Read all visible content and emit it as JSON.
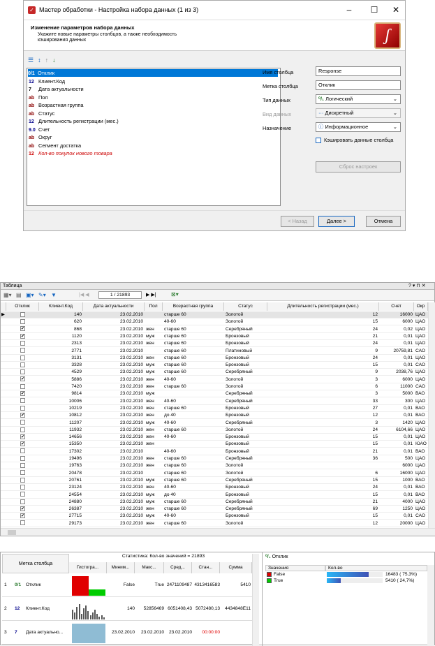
{
  "wizard": {
    "title": "Мастер обработки - Настройка набора данных (1 из 3)",
    "header_title": "Изменение параметров набора данных",
    "header_desc1": "Укажите новые параметры столбцов, а также необходимость",
    "header_desc2": "кэширования данных",
    "fields": [
      {
        "type": "0/1",
        "name": "Отклик",
        "color": "#006400",
        "selected": true
      },
      {
        "type": "12",
        "name": "Клиент.Код",
        "color": "#00008b"
      },
      {
        "type": "7",
        "name": "Дата актуальности",
        "color": "#000"
      },
      {
        "type": "ab",
        "name": "Пол",
        "color": "#8b0000"
      },
      {
        "type": "ab",
        "name": "Возрастная группа",
        "color": "#8b0000"
      },
      {
        "type": "ab",
        "name": "Статус",
        "color": "#8b0000"
      },
      {
        "type": "12",
        "name": "Длительность регистрации (мес.)",
        "color": "#00008b"
      },
      {
        "type": "9.0",
        "name": "Счет",
        "color": "#00008b"
      },
      {
        "type": "ab",
        "name": "Округ",
        "color": "#8b0000"
      },
      {
        "type": "ab",
        "name": "Сегмент достатка",
        "color": "#8b0000"
      },
      {
        "type": "12",
        "name": "Кол-во покупок нового товара",
        "color": "#cc0000",
        "italic": true
      }
    ],
    "labels": {
      "col_name": "Имя столбца",
      "col_label": "Метка столбца",
      "data_type": "Тип данных",
      "data_kind": "Вид данных",
      "purpose": "Назначение"
    },
    "values": {
      "col_name": "Response",
      "col_label": "Отклик",
      "data_type": "Логический",
      "data_kind": "Дискретный",
      "purpose": "Информационное"
    },
    "cache_label": "Кэшировать данные столбца",
    "reset_label": "Сброс настроек",
    "back_label": "< Назад",
    "next_label": "Далее >",
    "cancel_label": "Отмена"
  },
  "table": {
    "title": "Таблица",
    "nav": "1 / 21893",
    "columns": [
      "Отклик",
      "Клиент.Код",
      "Дата актуальности",
      "Пол",
      "Возрастная группа",
      "Статус",
      "Длительность регистрации (мес.)",
      "Счет",
      "Окр"
    ],
    "rows": [
      [
        false,
        "140",
        "23.02.2010",
        "",
        "старше 60",
        "Золотой",
        "12",
        "16000",
        "ЦАО"
      ],
      [
        false,
        "620",
        "23.02.2010",
        "",
        "40-60",
        "Золотой",
        "15",
        "6000",
        "ЦАО"
      ],
      [
        true,
        "868",
        "23.02.2010",
        "жен",
        "старше 60",
        "Серебряный",
        "24",
        "0,02",
        "ЦАО"
      ],
      [
        true,
        "1120",
        "23.02.2010",
        "муж",
        "старше 60",
        "Бронзовый",
        "21",
        "0,01",
        "ЦАО"
      ],
      [
        false,
        "2313",
        "23.02.2010",
        "жен",
        "старше 60",
        "Бронзовый",
        "24",
        "0,01",
        "ЦАО"
      ],
      [
        false,
        "2771",
        "23.02.2010",
        "",
        "старше 60",
        "Платиновый",
        "9",
        "20759,81",
        "САО"
      ],
      [
        false,
        "3131",
        "23.02.2010",
        "жен",
        "старше 60",
        "Бронзовый",
        "24",
        "0,01",
        "ЦАО"
      ],
      [
        false,
        "3328",
        "23.02.2010",
        "муж",
        "старше 60",
        "Бронзовый",
        "15",
        "0,01",
        "САО"
      ],
      [
        false,
        "4529",
        "23.02.2010",
        "муж",
        "старше 60",
        "Серебряный",
        "9",
        "2038,76",
        "ЦАО"
      ],
      [
        true,
        "5886",
        "23.02.2010",
        "жен",
        "40-60",
        "Золотой",
        "3",
        "6000",
        "ЦАО"
      ],
      [
        false,
        "7420",
        "23.02.2010",
        "жен",
        "старше 60",
        "Золотой",
        "6",
        "11000",
        "САО"
      ],
      [
        true,
        "9814",
        "23.02.2010",
        "муж",
        "",
        "Серебряный",
        "3",
        "5000",
        "ВАО"
      ],
      [
        false,
        "10006",
        "23.02.2010",
        "жен",
        "40-60",
        "Серебряный",
        "33",
        "300",
        "ЦАО"
      ],
      [
        false,
        "10219",
        "23.02.2010",
        "жен",
        "старше 60",
        "Бронзовый",
        "27",
        "0,01",
        "ВАО"
      ],
      [
        true,
        "10812",
        "23.02.2010",
        "жен",
        "до 40",
        "Бронзовый",
        "12",
        "0,01",
        "ВАО"
      ],
      [
        false,
        "11207",
        "23.02.2010",
        "муж",
        "40-60",
        "Серебряный",
        "3",
        "1420",
        "ЦАО"
      ],
      [
        false,
        "11932",
        "23.02.2010",
        "жен",
        "старше 60",
        "Золотой",
        "24",
        "6104,66",
        "ЦАО"
      ],
      [
        true,
        "14656",
        "23.02.2010",
        "жен",
        "40-60",
        "Бронзовый",
        "15",
        "0,01",
        "ЦАО"
      ],
      [
        true,
        "15350",
        "23.02.2010",
        "жен",
        "",
        "Бронзовый",
        "15",
        "0,01",
        "ЮАО"
      ],
      [
        false,
        "17302",
        "23.02.2010",
        "",
        "40-60",
        "Бронзовый",
        "21",
        "0,01",
        "ВАО"
      ],
      [
        false,
        "19496",
        "23.02.2010",
        "жен",
        "старше 60",
        "Серебряный",
        "36",
        "500",
        "ЦАО"
      ],
      [
        false,
        "19763",
        "23.02.2010",
        "жен",
        "старше 60",
        "Золотой",
        "",
        "6000",
        "ЦАО"
      ],
      [
        false,
        "20478",
        "23.02.2010",
        "",
        "старше 60",
        "Золотой",
        "6",
        "16000",
        "ЦАО"
      ],
      [
        false,
        "20761",
        "23.02.2010",
        "муж",
        "старше 60",
        "Серебряный",
        "15",
        "1000",
        "ВАО"
      ],
      [
        false,
        "23124",
        "23.02.2010",
        "жен",
        "40-60",
        "Бронзовый",
        "24",
        "0,01",
        "ВАО"
      ],
      [
        false,
        "24554",
        "23.02.2010",
        "муж",
        "до 40",
        "Бронзовый",
        "15",
        "0,01",
        "ВАО"
      ],
      [
        false,
        "24880",
        "23.02.2010",
        "муж",
        "старше 60",
        "Серебряный",
        "21",
        "4000",
        "ЦАО"
      ],
      [
        true,
        "26387",
        "23.02.2010",
        "жен",
        "старше 60",
        "Серебряный",
        "69",
        "1250",
        "ЦАО"
      ],
      [
        true,
        "27715",
        "23.02.2010",
        "муж",
        "40-60",
        "Бронзовый",
        "15",
        "0,01",
        "САО"
      ],
      [
        false,
        "29173",
        "23.02.2010",
        "жен",
        "старше 60",
        "Золотой",
        "12",
        "20000",
        "ЦАО"
      ]
    ]
  },
  "stats": {
    "header": "Статистика: Кол-во значений = 21893",
    "col_label": "Метка столбца",
    "col_headers": [
      "Гистогра...",
      "Миним...",
      "Макс...",
      "Сред...",
      "Стан...",
      "Сумма"
    ],
    "rows": [
      {
        "n": "1",
        "name": "Отклик",
        "type": "0/1",
        "min": "False",
        "max": "True",
        "avg": "2471109487",
        "std": "4313416583",
        "sum": "5410"
      },
      {
        "n": "2",
        "name": "Клиент.Код",
        "type": "12",
        "min": "140",
        "max": "52856469",
        "avg": "6051408,43",
        "std": "5072480,13",
        "sum": "4434848E11"
      },
      {
        "n": "3",
        "name": "Дата актуально...",
        "type": "7",
        "min": "23.02.2010",
        "max": "23.02.2010",
        "avg": "23.02.2010",
        "std": "00:00:00",
        "sum": ""
      }
    ],
    "right_title": "Отклик",
    "right_headers": [
      "Значения",
      "Кол-во"
    ],
    "right_rows": [
      {
        "name": "False",
        "color": "#e00000",
        "value": "16483 ( 75,3%)",
        "fraction": 0.753
      },
      {
        "name": "True",
        "color": "#00cc00",
        "value": "5410 ( 24,7%)",
        "fraction": 0.247
      }
    ]
  }
}
